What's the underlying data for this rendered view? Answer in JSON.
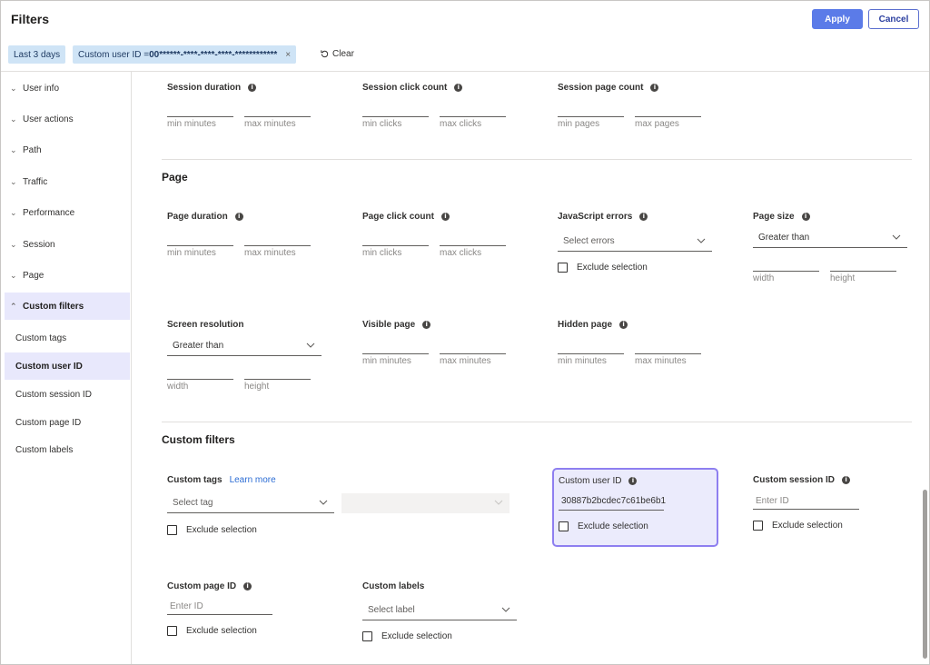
{
  "header": {
    "title": "Filters",
    "apply_label": "Apply",
    "cancel_label": "Cancel"
  },
  "chips": {
    "date": "Last 3 days",
    "user_id_prefix": "Custom user ID = ",
    "user_id_value": "00******-****-****-****-************",
    "remove_glyph": "×",
    "clear_label": "Clear"
  },
  "sidebar": {
    "items": [
      {
        "label": "User info"
      },
      {
        "label": "User actions"
      },
      {
        "label": "Path"
      },
      {
        "label": "Traffic"
      },
      {
        "label": "Performance"
      },
      {
        "label": "Session"
      },
      {
        "label": "Page"
      },
      {
        "label": "Custom filters"
      }
    ],
    "subitems": [
      {
        "label": "Custom tags"
      },
      {
        "label": "Custom user ID"
      },
      {
        "label": "Custom session ID"
      },
      {
        "label": "Custom page ID"
      },
      {
        "label": "Custom labels"
      }
    ]
  },
  "session": {
    "duration_label": "Session duration",
    "duration_min": "min minutes",
    "duration_max": "max minutes",
    "clicks_label": "Session click count",
    "clicks_min": "min clicks",
    "clicks_max": "max clicks",
    "pages_label": "Session page count",
    "pages_min": "min pages",
    "pages_max": "max pages"
  },
  "page": {
    "title": "Page",
    "duration_label": "Page duration",
    "duration_min": "min minutes",
    "duration_max": "max minutes",
    "clicks_label": "Page click count",
    "clicks_min": "min clicks",
    "clicks_max": "max clicks",
    "js_label": "JavaScript errors",
    "js_placeholder": "Select errors",
    "js_exclude": "Exclude selection",
    "size_label": "Page size",
    "size_value": "Greater than",
    "size_width": "width",
    "size_height": "height",
    "res_label": "Screen resolution",
    "res_value": "Greater than",
    "res_width": "width",
    "res_height": "height",
    "visible_label": "Visible page",
    "visible_min": "min minutes",
    "visible_max": "max minutes",
    "hidden_label": "Hidden page",
    "hidden_min": "min minutes",
    "hidden_max": "max minutes"
  },
  "custom": {
    "title": "Custom filters",
    "tags_label": "Custom tags",
    "tags_link": "Learn more",
    "tags_placeholder": "Select tag",
    "tags_exclude": "Exclude selection",
    "user_id_label": "Custom user ID",
    "user_id_value": "30887b2bcdec7c61be6b1",
    "user_id_exclude": "Exclude selection",
    "session_id_label": "Custom session ID",
    "session_id_placeholder": "Enter ID",
    "session_id_exclude": "Exclude selection",
    "page_id_label": "Custom page ID",
    "page_id_placeholder": "Enter ID",
    "page_id_exclude": "Exclude selection",
    "labels_label": "Custom labels",
    "labels_placeholder": "Select label",
    "labels_exclude": "Exclude selection"
  },
  "colors": {
    "accent": "#5b7be8",
    "chip_bg": "#cfe4f6",
    "active_nav_bg": "#e8e8fc",
    "highlight_border": "#8e7ff0"
  },
  "icons": {
    "info": "info-icon",
    "chevron_down": "chevron-down-icon",
    "chevron_up": "chevron-up-icon",
    "clear": "refresh-icon"
  }
}
